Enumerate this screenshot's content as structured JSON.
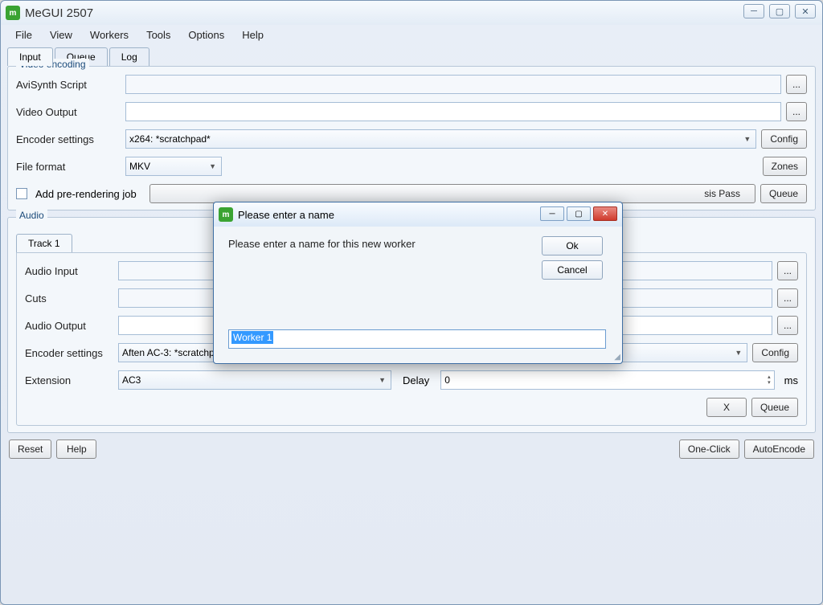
{
  "window": {
    "title": "MeGUI 2507"
  },
  "menu": {
    "file": "File",
    "view": "View",
    "workers": "Workers",
    "tools": "Tools",
    "options": "Options",
    "help": "Help"
  },
  "tabs": {
    "input": "Input",
    "queue": "Queue",
    "log": "Log"
  },
  "video": {
    "legend": "Video encoding",
    "avisynth_label": "AviSynth Script",
    "avisynth_value": "",
    "output_label": "Video Output",
    "output_value": "",
    "encoder_label": "Encoder settings",
    "encoder_value": "x264: *scratchpad*",
    "config": "Config",
    "format_label": "File format",
    "format_value": "MKV",
    "zones": "Zones",
    "prerender_label": "Add pre-rendering job",
    "analysis_partial": "sis Pass",
    "queue": "Queue",
    "browse": "..."
  },
  "audio": {
    "legend": "Audio",
    "track_tab": "Track 1",
    "input_label": "Audio Input",
    "input_value": "",
    "cuts_label": "Cuts",
    "cuts_value": "",
    "output_label": "Audio Output",
    "output_value": "",
    "encoder_label": "Encoder settings",
    "encoder_value": "Aften AC-3: *scratchpad*",
    "config": "Config",
    "extension_label": "Extension",
    "extension_value": "AC3",
    "delay_label": "Delay",
    "delay_value": "0",
    "delay_unit": "ms",
    "x": "X",
    "queue": "Queue",
    "browse": "..."
  },
  "bottom": {
    "reset": "Reset",
    "help": "Help",
    "oneclick": "One-Click",
    "autoencode": "AutoEncode"
  },
  "dialog": {
    "title": "Please enter a name",
    "message": "Please enter a name for this new worker",
    "ok": "Ok",
    "cancel": "Cancel",
    "input_value": "Worker 1"
  }
}
